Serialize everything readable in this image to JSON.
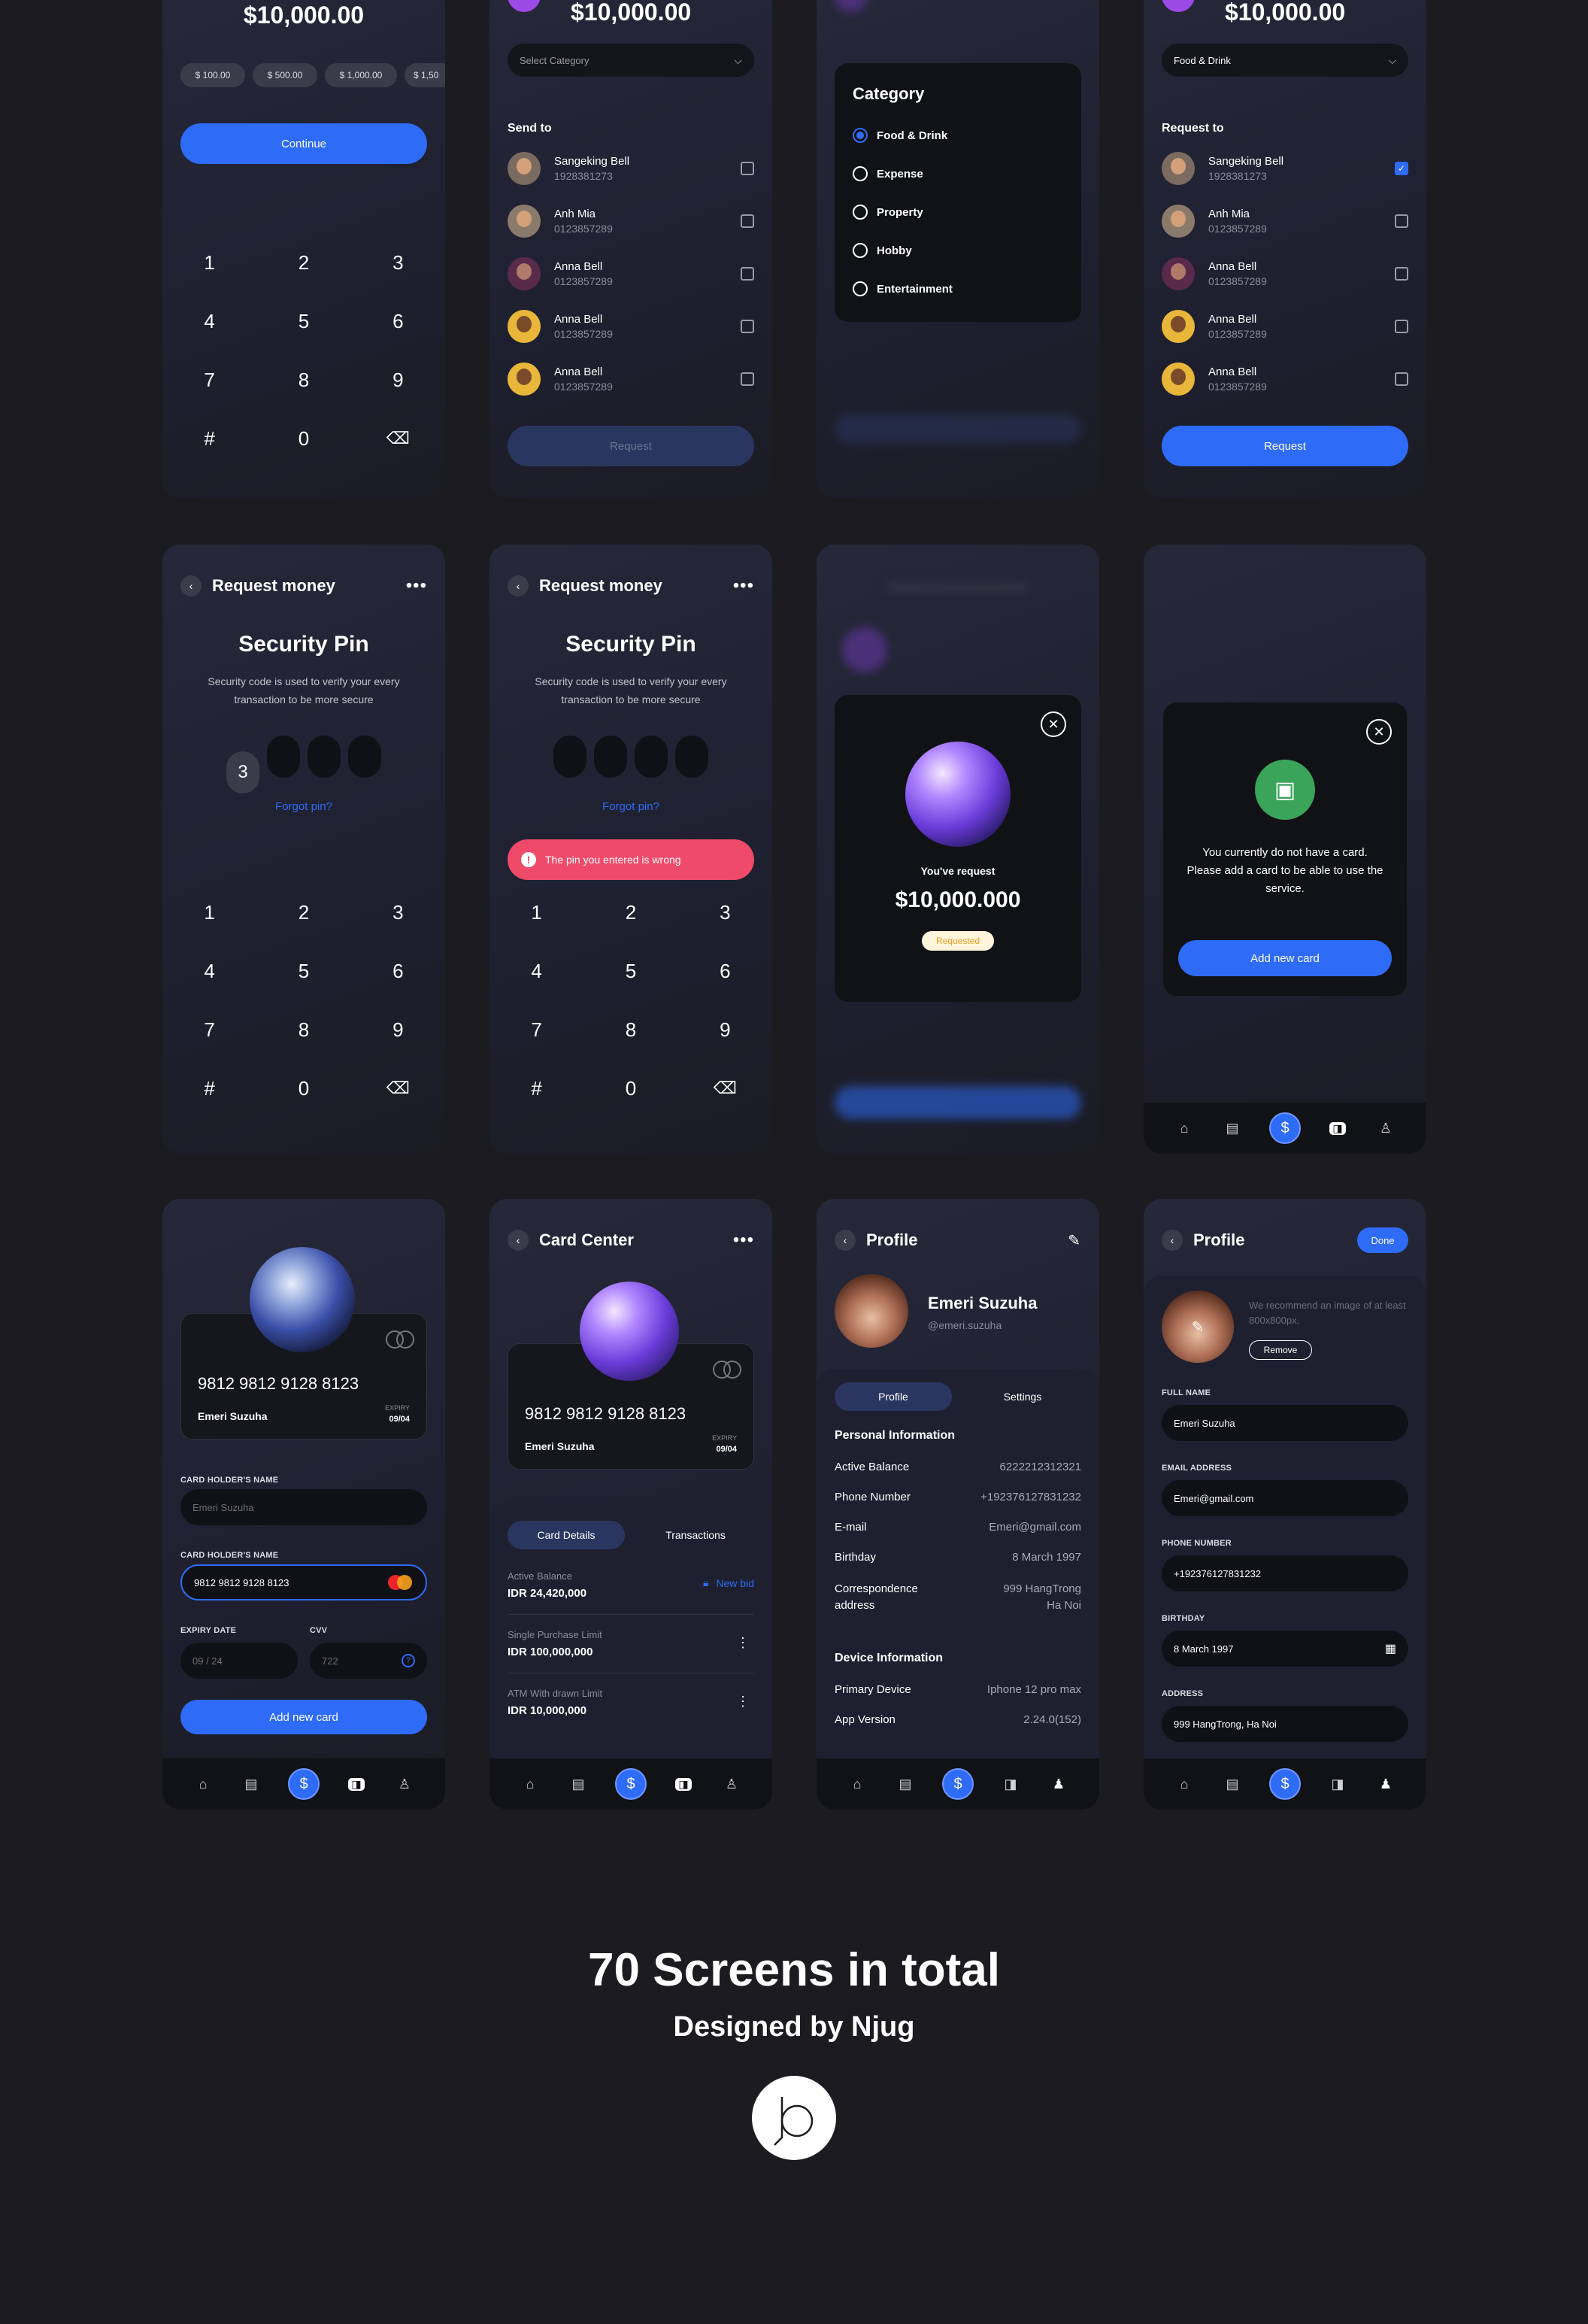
{
  "screens": {
    "amount_entry": {
      "amount": "$10,000.00",
      "quick_amounts": [
        "$ 100.00",
        "$ 500.00",
        "$ 1,000.00",
        "$ 1,50"
      ],
      "continue_label": "Continue",
      "keys": [
        "1",
        "2",
        "3",
        "4",
        "5",
        "6",
        "7",
        "8",
        "9",
        "#",
        "0",
        "backspace"
      ]
    },
    "request_send_to": {
      "amount": "$10,000.00",
      "category_placeholder": "Select Category",
      "section_title": "Send to",
      "contacts": [
        {
          "name": "Sangeking Bell",
          "phone": "1928381273",
          "checked": false
        },
        {
          "name": "Anh Mia",
          "phone": "0123857289",
          "checked": false
        },
        {
          "name": "Anna Bell",
          "phone": "0123857289",
          "checked": false
        },
        {
          "name": "Anna Bell",
          "phone": "0123857289",
          "checked": false
        },
        {
          "name": "Anna Bell",
          "phone": "0123857289",
          "checked": false
        }
      ],
      "request_label": "Request",
      "request_enabled": false
    },
    "category_picker": {
      "title": "Category",
      "options": [
        "Food & Drink",
        "Expense",
        "Property",
        "Hobby",
        "Entertainment"
      ],
      "selected": "Food & Drink"
    },
    "request_to": {
      "amount": "$10,000.00",
      "category_value": "Food & Drink",
      "section_title": "Request to",
      "contacts": [
        {
          "name": "Sangeking Bell",
          "phone": "1928381273",
          "checked": true
        },
        {
          "name": "Anh Mia",
          "phone": "0123857289",
          "checked": false
        },
        {
          "name": "Anna Bell",
          "phone": "0123857289",
          "checked": false
        },
        {
          "name": "Anna Bell",
          "phone": "0123857289",
          "checked": false
        },
        {
          "name": "Anna Bell",
          "phone": "0123857289",
          "checked": false
        }
      ],
      "request_label": "Request",
      "request_enabled": true
    },
    "security_pin_entry": {
      "header_title": "Request money",
      "title": "Security Pin",
      "description": "Security code is used to verify your every transaction to be more secure",
      "pin_digits": [
        "3",
        "",
        "",
        ""
      ],
      "forgot_label": "Forgot pin?",
      "keys": [
        "1",
        "2",
        "3",
        "4",
        "5",
        "6",
        "7",
        "8",
        "9",
        "#",
        "0",
        "backspace"
      ]
    },
    "security_pin_error": {
      "header_title": "Request money",
      "title": "Security Pin",
      "description": "Security code is used to verify your every transaction to be more secure",
      "pin_digits": [
        "",
        "",
        "",
        ""
      ],
      "forgot_label": "Forgot pin?",
      "error_message": "The pin you entered is wrong",
      "keys": [
        "1",
        "2",
        "3",
        "4",
        "5",
        "6",
        "7",
        "8",
        "9",
        "#",
        "0",
        "backspace"
      ]
    },
    "request_success": {
      "caption": "You've request",
      "amount": "$10,000.000",
      "status_badge": "Requested"
    },
    "no_card": {
      "message": "You currently do not have a card. Please add a card to be able to use the service.",
      "add_card_label": "Add new card"
    },
    "add_card": {
      "card_number": "9812 9812 9128 8123",
      "card_holder": "Emeri Suzuha",
      "expiry_label": "EXPIRY",
      "expiry_value": "09/04",
      "holder_name_label": "CARD HOLDER'S NAME",
      "holder_name_placeholder": "Emeri Suzuha",
      "card_number_label": "CARD HOLDER'S NAME",
      "card_number_value": "9812 9812 9128 8123",
      "expiry_date_label": "EXPIRY DATE",
      "expiry_date_placeholder": "09 / 24",
      "cvv_label": "CVV",
      "cvv_placeholder": "722",
      "add_card_label": "Add new card"
    },
    "card_center": {
      "header_title": "Card Center",
      "card_number": "9812 9812 9128 8123",
      "card_holder": "Emeri Suzuha",
      "expiry_label": "EXPIRY",
      "expiry_value": "09/04",
      "tabs": [
        "Card Details",
        "Transactions"
      ],
      "active_tab": "Card Details",
      "new_bid_label": "New bid",
      "items": [
        {
          "label": "Active Balance",
          "value": "IDR 24,420,000"
        },
        {
          "label": "Single Purchase Limit",
          "value": "IDR 100,000,000"
        },
        {
          "label": "ATM With drawn Limit",
          "value": "IDR 10,000,000"
        }
      ]
    },
    "profile": {
      "header_title": "Profile",
      "name": "Emeri Suzuha",
      "handle": "@emeri.suzuha",
      "tabs": [
        "Profile",
        "Settings"
      ],
      "active_tab": "Profile",
      "personal_title": "Personal Information",
      "personal": [
        {
          "label": "Active Balance",
          "value": "6222212312321"
        },
        {
          "label": "Phone Number",
          "value": "+192376127831232"
        },
        {
          "label": "E-mail",
          "value": "Emeri@gmail.com"
        },
        {
          "label": "Birthday",
          "value": "8 March 1997"
        },
        {
          "label": "Correspondence address",
          "value": "999 HangTrong Ha Noi"
        }
      ],
      "device_title": "Device Information",
      "device": [
        {
          "label": "Primary Device",
          "value": "Iphone 12 pro max"
        },
        {
          "label": "App Version",
          "value": "2.24.0(152)"
        }
      ]
    },
    "edit_profile": {
      "header_title": "Profile",
      "done_label": "Done",
      "avatar_hint": "We recommend an image of at least 800x800px.",
      "remove_label": "Remove",
      "fields": [
        {
          "label": "FULL NAME",
          "value": "Emeri Suzuha"
        },
        {
          "label": "EMAIL ADDRESS",
          "value": "Emeri@gmail.com"
        },
        {
          "label": "PHONE NUMBER",
          "value": "+192376127831232"
        },
        {
          "label": "BIRTHDAY",
          "value": "8 March 1997"
        },
        {
          "label": "ADDRESS",
          "value": "999 HangTrong, Ha Noi"
        }
      ]
    }
  },
  "nav_icons": [
    "home-icon",
    "chart-icon",
    "dollar-icon",
    "wallet-icon",
    "user-icon"
  ],
  "footer": {
    "headline": "70 Screens in total",
    "credit": "Designed by Njug"
  },
  "colors": {
    "accent": "#2e6bf6",
    "background": "#1c1c20",
    "error": "#ef4a6a",
    "success": "#3aa55a"
  }
}
